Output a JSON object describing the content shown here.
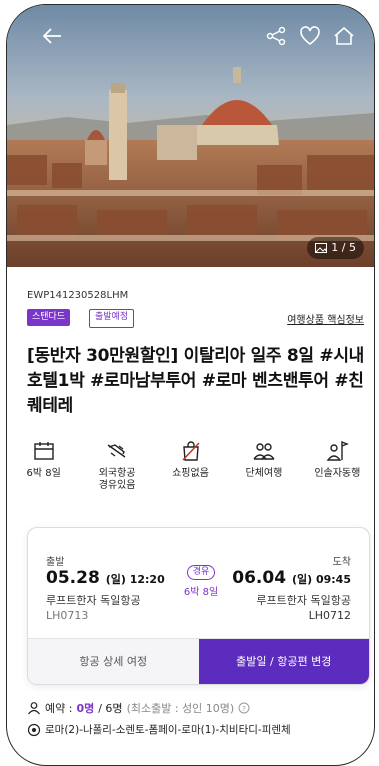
{
  "product": {
    "code": "EWP141230528LHM",
    "badges": [
      "스탠다드",
      "출발예정"
    ],
    "key_info_link": "여행상품 핵심정보",
    "title": "[동반자 30만원할인] 이탈리아 일주 8일 #시내호텔1박 #로마남부투어 #로마 벤츠밴투어 #친퀘테레"
  },
  "gallery": {
    "counter": "1 / 5"
  },
  "features": [
    {
      "icon": "calendar-icon",
      "label": "6박 8일"
    },
    {
      "icon": "airplane-icon",
      "label": "외국항공\n경유있음"
    },
    {
      "icon": "shopping-bag-icon",
      "label": "쇼핑없음"
    },
    {
      "icon": "group-icon",
      "label": "단체여행"
    },
    {
      "icon": "guide-flag-icon",
      "label": "인솔자동행"
    }
  ],
  "flight": {
    "departure_label": "출발",
    "arrival_label": "도착",
    "departure_date": "05.28",
    "departure_day_time": "(일) 12:20",
    "arrival_date": "06.04",
    "arrival_day_time": "(일) 09:45",
    "transit": "경유",
    "duration": "6박 8일",
    "departure_airline": "루프트한자 독일항공",
    "arrival_airline": "루프트한자 독일항공",
    "departure_flight_no": "LH0713",
    "arrival_flight_no": "LH0712",
    "detail_button": "항공 상세 여정",
    "change_button": "출발일 / 항공편 변경"
  },
  "booking": {
    "label": "예약 :",
    "current": "0명",
    "total": "/ 6명",
    "minimum": "(최소출발 : 성인 10명)"
  },
  "route": "로마(2)-나폴리-소렌토-폼페이-로마(1)-치비타디-피렌체",
  "colors": {
    "accent": "#7a35c9",
    "button": "#5c2cbf"
  }
}
